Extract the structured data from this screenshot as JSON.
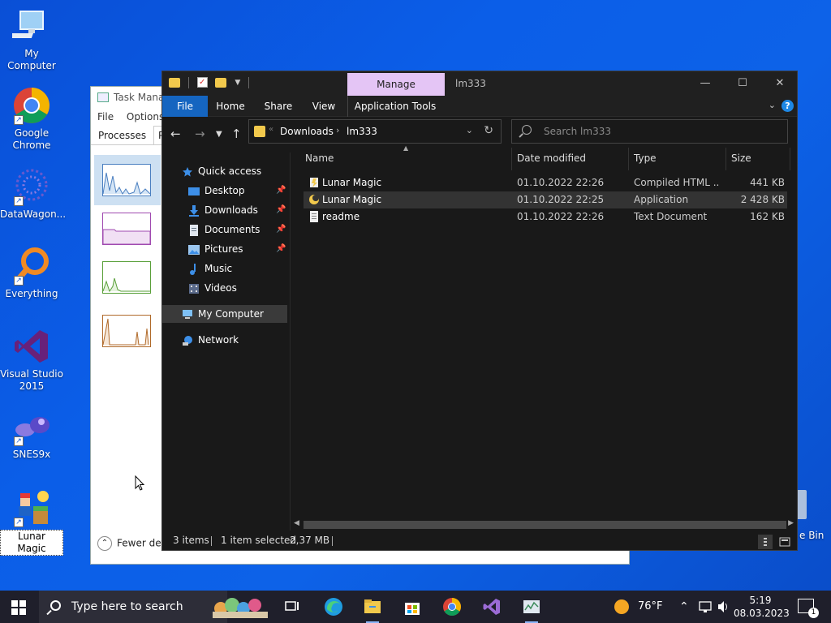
{
  "desktop": {
    "icons": [
      {
        "label": "My Computer"
      },
      {
        "label": "Google Chrome"
      },
      {
        "label": "DataWagon..."
      },
      {
        "label": "Everything"
      },
      {
        "label": "Visual Studio 2015"
      },
      {
        "label": "SNES9x"
      },
      {
        "label": "Lunar Magic"
      }
    ],
    "recycle_bin_label": "e Bin"
  },
  "taskmanager": {
    "title": "Task Manag",
    "menu": [
      "File",
      "Options"
    ],
    "tabs": [
      "Processes",
      "Per"
    ],
    "fewer_details": "Fewer det"
  },
  "explorer": {
    "title": "lm333",
    "manage_tab": "Manage",
    "ribbon_tabs": [
      "File",
      "Home",
      "Share",
      "View",
      "Application Tools"
    ],
    "address": {
      "crumbs": [
        "Downloads",
        "lm333"
      ]
    },
    "search_placeholder": "Search lm333",
    "nav": {
      "quick_access": "Quick access",
      "items": [
        {
          "label": "Desktop",
          "pinned": true
        },
        {
          "label": "Downloads",
          "pinned": true
        },
        {
          "label": "Documents",
          "pinned": true
        },
        {
          "label": "Pictures",
          "pinned": true
        },
        {
          "label": "Music",
          "pinned": false
        },
        {
          "label": "Videos",
          "pinned": false
        }
      ],
      "my_computer": "My Computer",
      "network": "Network"
    },
    "columns": {
      "name": "Name",
      "date": "Date modified",
      "type": "Type",
      "size": "Size"
    },
    "files": [
      {
        "name": "Lunar Magic",
        "date": "01.10.2022 22:26",
        "type": "Compiled HTML ...",
        "size": "441 KB",
        "icon": "chm-icon"
      },
      {
        "name": "Lunar Magic",
        "date": "01.10.2022 22:25",
        "type": "Application",
        "size": "2 428 KB",
        "icon": "app-icon"
      },
      {
        "name": "readme",
        "date": "01.10.2022 22:26",
        "type": "Text Document",
        "size": "162 KB",
        "icon": "text-file-icon"
      }
    ],
    "status": {
      "items": "3 items",
      "selected": "1 item selected",
      "size": "2,37 MB"
    }
  },
  "taskbar": {
    "search_placeholder": "Type here to search",
    "weather": "76°F",
    "time": "5:19",
    "date": "08.03.2023",
    "notification_count": "1"
  },
  "colors": {
    "accent": "#1565c0",
    "manage_tab": "#e4c5f5",
    "explorer_bg": "#191919",
    "desktop": "#0b5ee8"
  }
}
